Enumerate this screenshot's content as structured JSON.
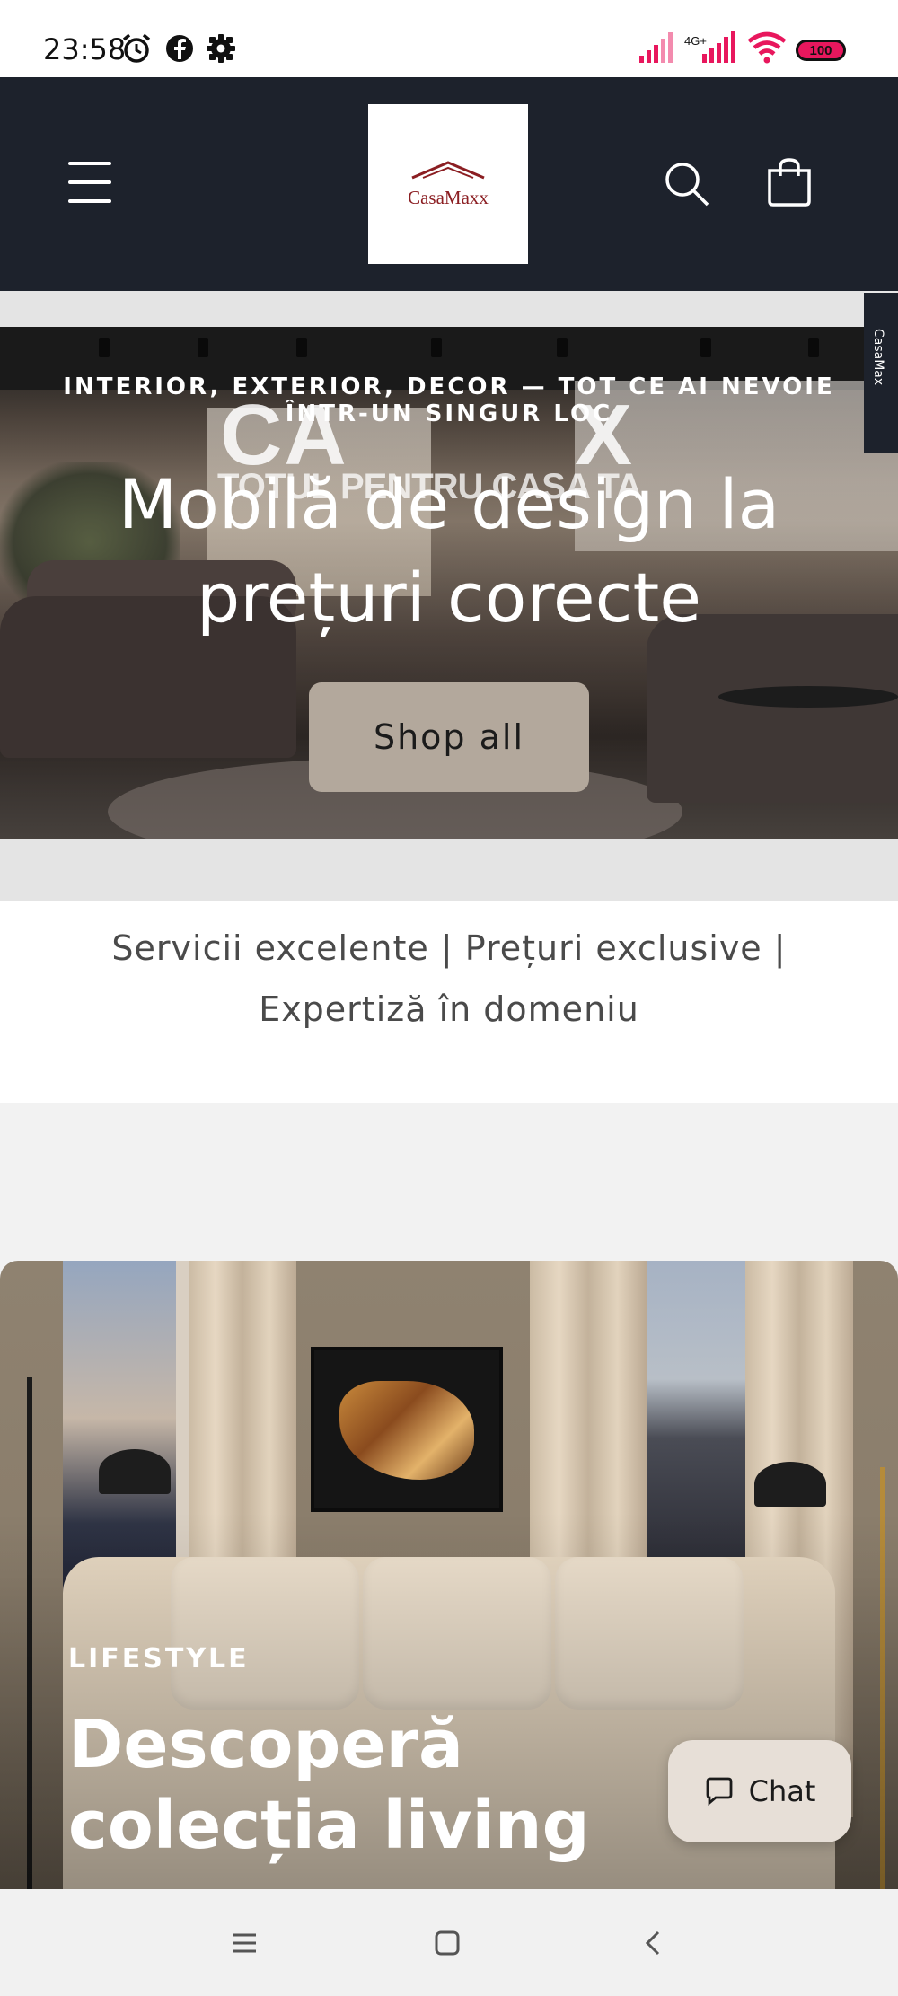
{
  "status_bar": {
    "time": "23:58",
    "network": "4G+",
    "battery": "100"
  },
  "header": {
    "logo_text": "CasaMaxx"
  },
  "side_tab": {
    "label": "CasaMax"
  },
  "hero": {
    "eyebrow": "INTERIOR, EXTERIOR, DECOR — TOT CE AI NEVOIE ÎNTR-UN SINGUR LOC",
    "title": "Mobilă de design la prețuri corecte",
    "button_label": "Shop all",
    "image_brand": "CA",
    "image_brand_tail": "X",
    "image_tagline": "TOTUL PENTRU CASA TA"
  },
  "text_band": {
    "line1": "Servicii excelente | Prețuri exclusive |",
    "line2": "Expertiză în domeniu"
  },
  "lifestyle": {
    "eyebrow": "LIFESTYLE",
    "title": "Descoperă colecția living"
  },
  "chat": {
    "label": "Chat"
  },
  "icons": {
    "menu": "hamburger-icon",
    "search": "search-icon",
    "cart": "cart-icon",
    "alarm": "alarm-icon",
    "facebook": "facebook-icon",
    "settings": "gear-icon",
    "chat": "chat-bubble-icon"
  },
  "colors": {
    "header_bg": "#1d222c",
    "button_bg": "#b3a89c",
    "logo_red": "#8b1e22",
    "signal_pink": "#e8175d"
  }
}
